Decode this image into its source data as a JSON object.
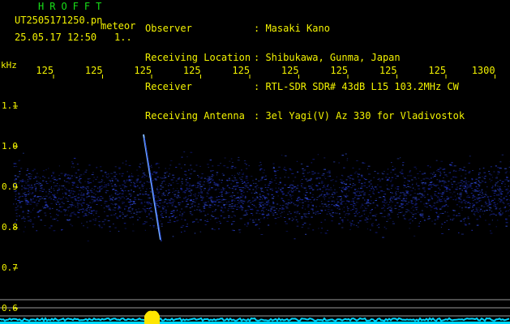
{
  "header": {
    "brand": "HROFFT",
    "filename": "UT2505171250.pn",
    "tag": "meteor",
    "timestamp": "25.05.17 12:50",
    "index": "1.."
  },
  "meta": {
    "rows": [
      {
        "label": "Observer",
        "value": ": Masaki Kano"
      },
      {
        "label": "Receiving Location",
        "value": ": Shibukawa, Gunma, Japan"
      },
      {
        "label": "Receiver",
        "value": ": RTL-SDR SDR# 43dB L15 103.2MHz CW"
      },
      {
        "label": "Receiving Antenna",
        "value": ": 3el Yagi(V) Az 330 for Vladivostok"
      }
    ]
  },
  "axes": {
    "y_unit": "kHz",
    "x_ticks": [
      "125",
      "125",
      "125",
      "125",
      "125",
      "125",
      "125",
      "125",
      "125",
      "1300"
    ],
    "y_ticks": [
      "1.1",
      "1.0",
      "0.9",
      "0.8",
      "0.7",
      "0.6"
    ]
  },
  "colors": {
    "background": "#000000",
    "text": "#f2f200",
    "brand": "#18e018",
    "noise": "#1f2fb0",
    "trail": "#7fb6ff",
    "baseline": "#00d8ff",
    "spike": "#ffe600"
  },
  "chart_data": {
    "type": "heatmap",
    "title": "",
    "xlabel": "",
    "ylabel": "kHz",
    "ylim": [
      0.59,
      1.15
    ],
    "noise_band_khz": [
      0.78,
      0.98
    ],
    "meteor_trail": {
      "start_khz": 1.03,
      "end_khz": 0.77
    },
    "grid": false
  }
}
